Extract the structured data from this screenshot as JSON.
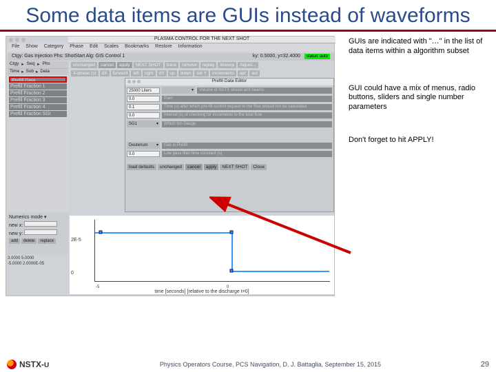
{
  "title": "Some data items are GUIs instead of waveforms",
  "notes": {
    "n1": "GUIs are indicated with \"…\" in the list of data items within a algorithm subset",
    "n2": "GUI could have a mix of menus, radio buttons, sliders and single number parameters",
    "n3": "Don't forget to hit APPLY!"
  },
  "shot": {
    "win_title": "PLASMA CONTROL FOR THE NEXT SHOT",
    "menubar": [
      "File",
      "Show",
      "Category",
      "Phase",
      "Edit",
      "Scales",
      "Bookmarks",
      "Restore",
      "Information"
    ],
    "subbar_left": "Ctgy: Gas Injection   Phs: ShotStart   Alg: GIS Control 1",
    "subbar_right_pre": "ky: 0.5000, y=32.4000",
    "subbar_status": "status: auto",
    "side_tabs": [
      "Ctgy",
      "Seq",
      "Phs"
    ],
    "side_sub": [
      "Time",
      "Sub",
      "Data"
    ],
    "side_items": [
      "Prefill Data...",
      "Prefill Fraction 1",
      "Prefill Fraction 2",
      "Prefill Fraction 3",
      "Prefill Fraction 4",
      "Prefill Fraction SGI"
    ],
    "toolbar2": [
      "unchanged",
      "cancel",
      "apply",
      "NEXT SHOT",
      "trace",
      "remove",
      "replay",
      "blowup",
      "Adjust..."
    ],
    "toolbar3": [
      "X-phase (s)",
      "dX",
      "forward",
      "left",
      "right",
      "dY",
      "up",
      "down",
      "set Y",
      "increments",
      "apr",
      "act"
    ],
    "editor": {
      "title": "Prefill Data Editor",
      "rows": [
        {
          "field": "25000 Liters",
          "drop": "",
          "label": "Volume of NSTX vessel and beams"
        },
        {
          "field": "0.0",
          "drop": "",
          "label": "Gain"
        },
        {
          "field": "0.1",
          "drop": "",
          "label": "Time (s) after which pre-fill control request to the flow should not be calculated"
        },
        {
          "field": "0.0",
          "drop": "",
          "label": "Interval (s) of checking for increments to the total flow"
        },
        {
          "field": "",
          "drop": "SG1",
          "label": "Which Ion Gauge"
        },
        {
          "field": "",
          "drop": "Deuterium",
          "label": "Gas in Prefill"
        },
        {
          "field": "0.0",
          "drop": "",
          "label": "Low pass filter time constant (s)"
        }
      ],
      "btns": [
        "load defaults",
        "unchanged",
        "cancel",
        "apply",
        "NEXT SHOT",
        "Close"
      ]
    },
    "num_mode_label": "Numerics mode ▾",
    "newx": "new x:",
    "newy": "new y:",
    "nm_btns": [
      "add",
      "delete",
      "replace"
    ],
    "values": [
      "3.0000   5.0000",
      "-5.0000  2.0000E-05"
    ]
  },
  "chart_data": {
    "type": "line",
    "title": "",
    "xlabel": "time [seconds] [relative to the discharge t=0]",
    "ylabel": "",
    "x": [
      -5.5,
      -5,
      0,
      0,
      3
    ],
    "y": [
      0,
      2e-05,
      2e-05,
      0,
      0
    ],
    "xticks": [
      -5,
      0
    ],
    "yticks": [
      0,
      2e-05
    ],
    "ytick_labels": [
      "0",
      "2E-5"
    ],
    "xlim": [
      -6,
      3
    ],
    "ylim": [
      -2e-06,
      2.4e-05
    ]
  },
  "footer": {
    "logo": "NSTX-U",
    "center": "Physics Operators Course, PCS Navigation, D. J. Battaglia, September 15, 2015",
    "page": "29"
  }
}
